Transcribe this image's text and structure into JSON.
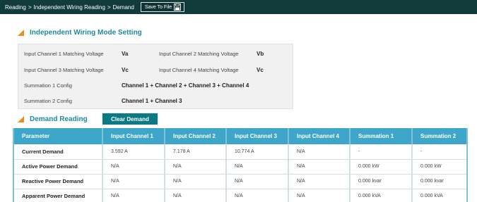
{
  "topbar": {
    "breadcrumb": [
      "Reading",
      "Independent Wiring Reading",
      "Demand"
    ],
    "separator": ">",
    "save_label": "Save To File",
    "save_icon": "floppy-disk-icon"
  },
  "wiring_section": {
    "title": "Independent Wiring Mode Setting",
    "rows": [
      {
        "label1": "Input Channel 1 Matching Voltage",
        "value1": "Va",
        "label2": "Input Channel 2 Matching Voltage",
        "value2": "Vb"
      },
      {
        "label1": "Input Channel 3 Matching Voltage",
        "value1": "Vc",
        "label2": "Input Channel 4 Matching Voltage",
        "value2": "Vc"
      },
      {
        "label1": "Summation 1 Config",
        "value1": "Channel 1 + Channel 2 + Channel 3 + Channel 4"
      },
      {
        "label1": "Summation 2 Config",
        "value1": "Channel 1 + Channel 3"
      }
    ]
  },
  "demand_section": {
    "title": "Demand Reading",
    "clear_label": "Clear Demand",
    "columns": [
      "Parameter",
      "Input Channel 1",
      "Input Channel 2",
      "Input Channel 3",
      "Input Channel 4",
      "Summation 1",
      "Summation 2"
    ],
    "rows": [
      [
        "Current Demand",
        "3.592 A",
        "7.178 A",
        "10.774 A",
        "N/A",
        "-",
        "-"
      ],
      [
        "Active Power Demand",
        "N/A",
        "N/A",
        "N/A",
        "N/A",
        "0.000 kW",
        "0.000 kW"
      ],
      [
        "Reactive Power Demand",
        "N/A",
        "N/A",
        "N/A",
        "N/A",
        "0.000 kvar",
        "0.000 kvar"
      ],
      [
        "Apparent Power Demand",
        "N/A",
        "N/A",
        "N/A",
        "N/A",
        "0.000 kVA",
        "0.000 kVA"
      ]
    ]
  },
  "colors": {
    "topbar_bg": "#123b3b",
    "section_title": "#1c8aa0",
    "section_icon": "#e8901a",
    "clear_button": "#0a7b86",
    "table_header": "#3ea6c9"
  }
}
